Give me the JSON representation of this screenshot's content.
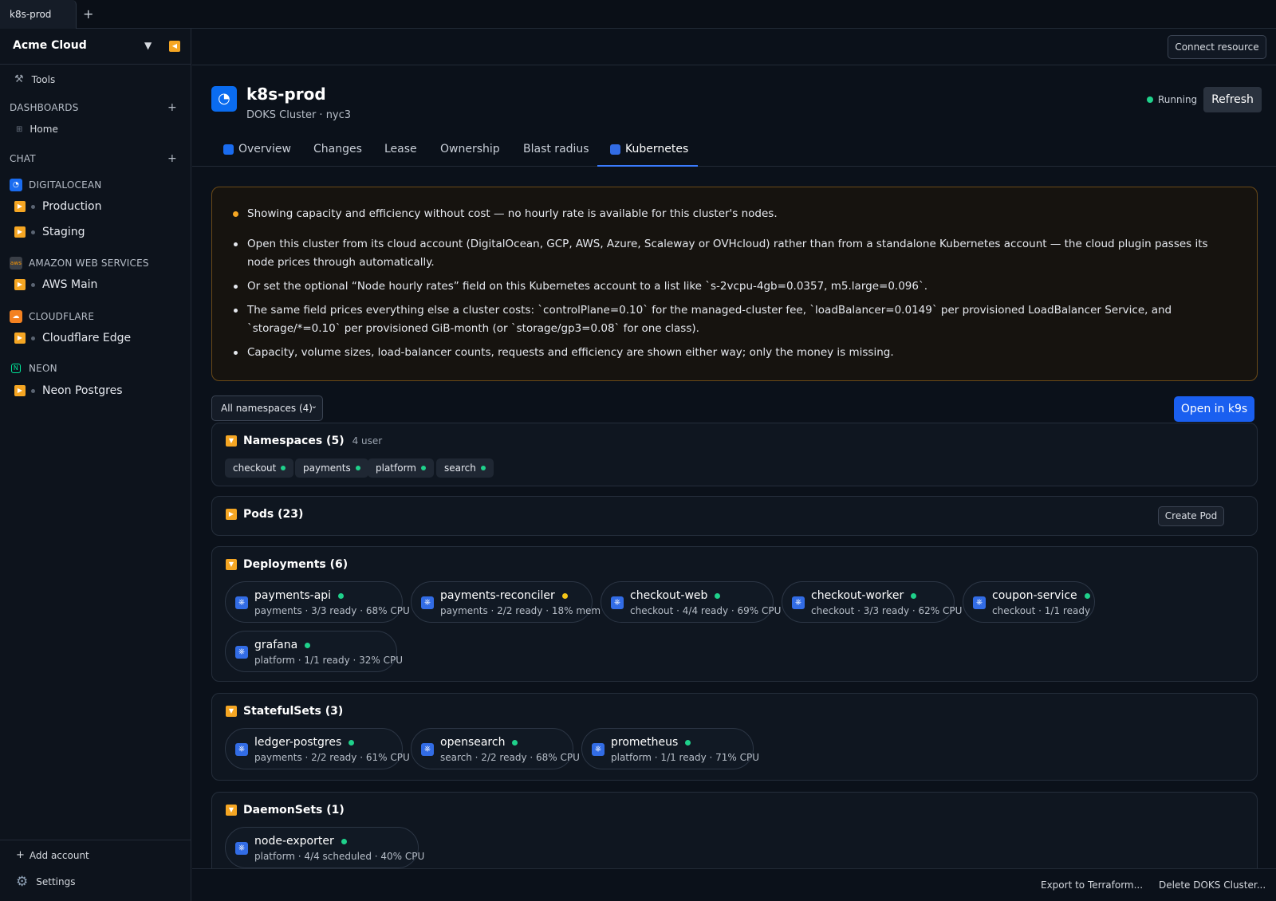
{
  "window": {
    "tab_label": "k8s-prod",
    "new_tab": "+"
  },
  "sidebar": {
    "org_name": "Acme Cloud",
    "tools_label": "Tools",
    "dashboards_label": "DASHBOARDS",
    "home_label": "Home",
    "chat_label": "CHAT",
    "providers": [
      {
        "name": "DIGITALOCEAN",
        "color": "#1a6cf0",
        "accounts": [
          "Production",
          "Staging"
        ]
      },
      {
        "name": "AMAZON WEB SERVICES",
        "color": "#232f3e",
        "accounts": [
          "AWS Main"
        ]
      },
      {
        "name": "CLOUDFLARE",
        "color": "#f48120",
        "accounts": [
          "Cloudflare Edge"
        ]
      },
      {
        "name": "NEON",
        "color": "#00e599",
        "accounts": [
          "Neon Postgres"
        ]
      }
    ],
    "add_account": "Add account",
    "settings": "Settings"
  },
  "topbar": {
    "connect_resource": "Connect resource"
  },
  "resource": {
    "title": "k8s-prod",
    "subtitle": "DOKS Cluster · nyc3",
    "status": "Running",
    "refresh": "Refresh"
  },
  "tabs": [
    "Overview",
    "Changes",
    "Lease",
    "Ownership",
    "Blast radius",
    "Kubernetes"
  ],
  "active_tab": "Kubernetes",
  "warning": {
    "headline": "Showing capacity and efficiency without cost — no hourly rate is available for this cluster's nodes.",
    "bullets": [
      "Open this cluster from its cloud account (DigitalOcean, GCP, AWS, Azure, Scaleway or OVHcloud) rather than from a standalone Kubernetes account — the cloud plugin passes its node prices through automatically.",
      "Or set the optional “Node hourly rates” field on this Kubernetes account to a list like `s-2vcpu-4gb=0.0357, m5.large=0.096`.",
      "The same field prices everything else a cluster costs: `controlPlane=0.10` for the managed-cluster fee, `loadBalancer=0.0149` per provisioned LoadBalancer Service, and `storage/*=0.10` per provisioned GiB-month (or `storage/gp3=0.08` for one class).",
      "Capacity, volume sizes, load-balancer counts, requests and efficiency are shown either way; only the money is missing."
    ]
  },
  "namespace_select": "All namespaces (4)",
  "open_k9s": "Open in k9s",
  "namespaces": {
    "title": "Namespaces (5)",
    "meta": "4 user",
    "items": [
      "checkout",
      "payments",
      "platform",
      "search"
    ]
  },
  "pods": {
    "title": "Pods (23)",
    "create": "Create Pod"
  },
  "deployments": {
    "title": "Deployments (6)",
    "items": [
      {
        "name": "payments-api",
        "detail": "payments · 3/3 ready · 68% CPU",
        "status": "ok"
      },
      {
        "name": "payments-reconciler",
        "detail": "payments · 2/2 ready · 18% mem",
        "status": "warn"
      },
      {
        "name": "checkout-web",
        "detail": "checkout · 4/4 ready · 69% CPU",
        "status": "ok"
      },
      {
        "name": "checkout-worker",
        "detail": "checkout · 3/3 ready · 62% CPU",
        "status": "ok"
      },
      {
        "name": "coupon-service",
        "detail": "checkout · 1/1 ready",
        "status": "ok"
      },
      {
        "name": "grafana",
        "detail": "platform · 1/1 ready · 32% CPU",
        "status": "ok"
      }
    ]
  },
  "statefulsets": {
    "title": "StatefulSets (3)",
    "items": [
      {
        "name": "ledger-postgres",
        "detail": "payments · 2/2 ready · 61% CPU",
        "status": "ok"
      },
      {
        "name": "opensearch",
        "detail": "search · 2/2 ready · 68% CPU",
        "status": "ok"
      },
      {
        "name": "prometheus",
        "detail": "platform · 1/1 ready · 71% CPU",
        "status": "ok"
      }
    ]
  },
  "daemonsets": {
    "title": "DaemonSets (1)",
    "items": [
      {
        "name": "node-exporter",
        "detail": "platform · 4/4 scheduled · 40% CPU",
        "status": "ok"
      }
    ]
  },
  "footer": {
    "export": "Export to Terraform...",
    "delete": "Delete DOKS Cluster..."
  },
  "colors": {
    "accent": "#1a5ff0",
    "ok": "#1fd18b",
    "warn": "#f5c518",
    "toggle": "#f5a623"
  }
}
